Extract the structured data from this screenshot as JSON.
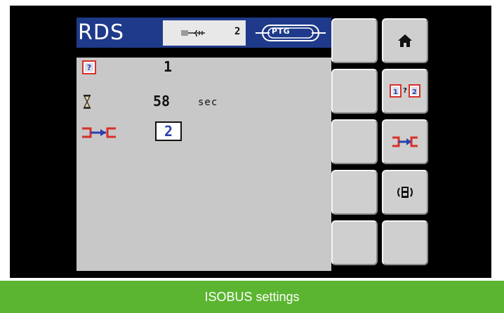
{
  "header": {
    "logo_text": "RDS",
    "working_set_number": "2",
    "brand_logo": "PTG",
    "working_set_icon": "implement-connector-icon"
  },
  "parameters": [
    {
      "icon": "help-question-icon",
      "value": "1",
      "unit": ""
    },
    {
      "icon": "hourglass-icon",
      "value": "58",
      "unit": "sec"
    },
    {
      "icon": "coupling-icon",
      "value": "2",
      "unit": ""
    }
  ],
  "softkeys": {
    "column_a": [
      "",
      "",
      "",
      "",
      ""
    ],
    "column_b_icons": [
      "home-icon",
      "swap-1-2-icon",
      "coupling-icon",
      "mode-toggle-icon",
      ""
    ]
  },
  "footer": {
    "caption": "ISOBUS settings"
  },
  "colors": {
    "header_blue": "#1f3a8a",
    "panel_grey": "#c8c8c8",
    "footer_green": "#5bb530",
    "accent_red": "#d8302a",
    "accent_blue": "#2b3fae"
  }
}
